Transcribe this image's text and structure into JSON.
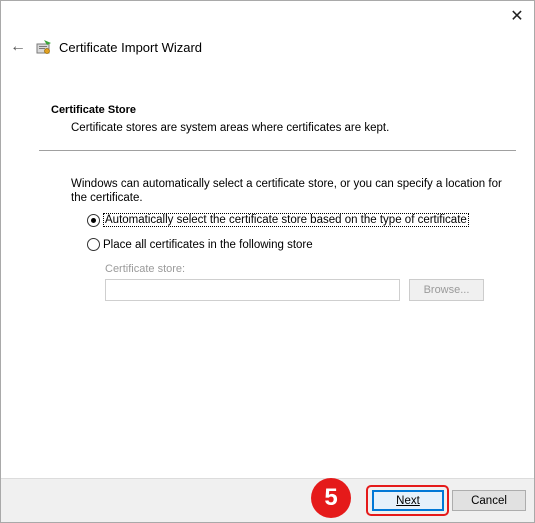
{
  "window": {
    "close_glyph": "✕"
  },
  "header": {
    "back_glyph": "←",
    "icon": "certificate-wizard-icon",
    "title": "Certificate Import Wizard"
  },
  "section": {
    "heading": "Certificate Store",
    "description": "Certificate stores are system areas where certificates are kept."
  },
  "intro": "Windows can automatically select a certificate store, or you can specify a location for the certificate.",
  "options": {
    "auto": {
      "label": "Automatically select the certificate store based on the type of certificate",
      "selected": true
    },
    "manual": {
      "label": "Place all certificates in the following store",
      "selected": false
    }
  },
  "store": {
    "label": "Certificate store:",
    "value": "",
    "browse_label": "Browse..."
  },
  "footer": {
    "step_number": "5",
    "next_label": "Next",
    "cancel_label": "Cancel"
  },
  "colors": {
    "highlight": "#e51a1a",
    "accent": "#0078d7"
  }
}
